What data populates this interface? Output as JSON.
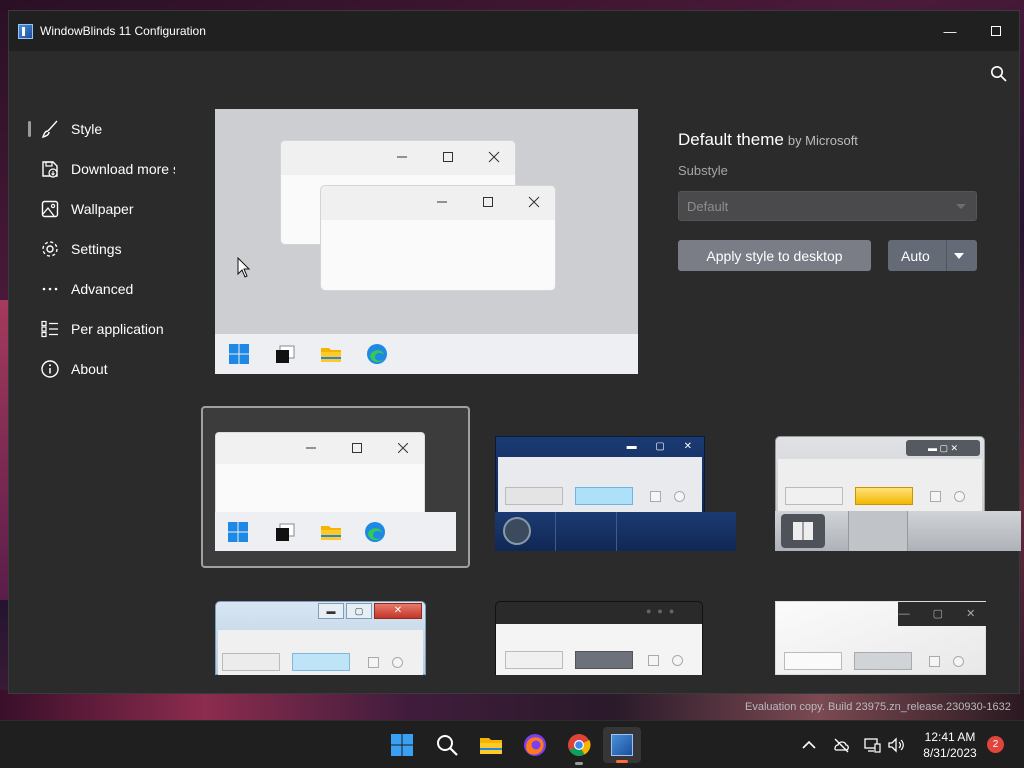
{
  "window": {
    "title": "WindowBlinds 11 Configuration",
    "minimize_glyph": "—"
  },
  "sidebar": {
    "items": [
      {
        "label": "Style",
        "icon": "brush-icon"
      },
      {
        "label": "Download more s",
        "icon": "download-icon"
      },
      {
        "label": "Wallpaper",
        "icon": "image-icon"
      },
      {
        "label": "Settings",
        "icon": "gear-icon"
      },
      {
        "label": "Advanced",
        "icon": "more-icon"
      },
      {
        "label": "Per application",
        "icon": "list-icon"
      },
      {
        "label": "About",
        "icon": "info-icon"
      }
    ]
  },
  "theme": {
    "name": "Default theme",
    "author": "by Microsoft",
    "substyle_label": "Substyle",
    "substyle_value": "Default",
    "apply_label": "Apply style to desktop",
    "auto_label": "Auto"
  },
  "watermark": "Evaluation copy. Build 23975.zn_release.230930-1632",
  "taskbar": {
    "time": "12:41 AM",
    "date": "8/31/2023",
    "notifications": "2"
  },
  "colors": {
    "accent": "#0078d4",
    "window_bg": "#2b2b2b",
    "titlebar_bg": "#202020"
  }
}
